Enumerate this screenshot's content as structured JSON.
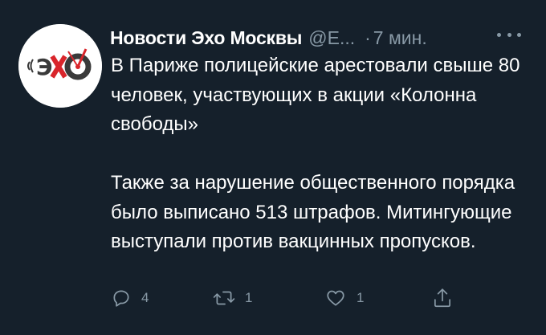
{
  "tweet": {
    "author_name": "Новости Эхо Москвы",
    "author_handle": "@Е...",
    "separator": "·",
    "time": "7 мин.",
    "avatar_logo_text": "ЭХО",
    "paragraphs": [
      "В Париже полицейские арестовали свыше 80 человек, участвующих в акции «Колонна свободы»",
      "Также за нарушение общественного порядка было выписано 513 штрафов. Митингующие выступали против вакцинных пропусков."
    ],
    "actions": {
      "reply_count": "4",
      "retweet_count": "1",
      "like_count": "1"
    }
  },
  "colors": {
    "background": "#15202b",
    "text_primary": "#ffffff",
    "text_secondary": "#8899a6",
    "logo_red": "#d9252b",
    "logo_dark": "#3a3a3a"
  },
  "icons": {
    "reply": "speech-bubble-icon",
    "retweet": "retweet-arrows-icon",
    "like": "heart-icon",
    "share": "share-upload-icon",
    "more": "ellipsis-icon"
  }
}
